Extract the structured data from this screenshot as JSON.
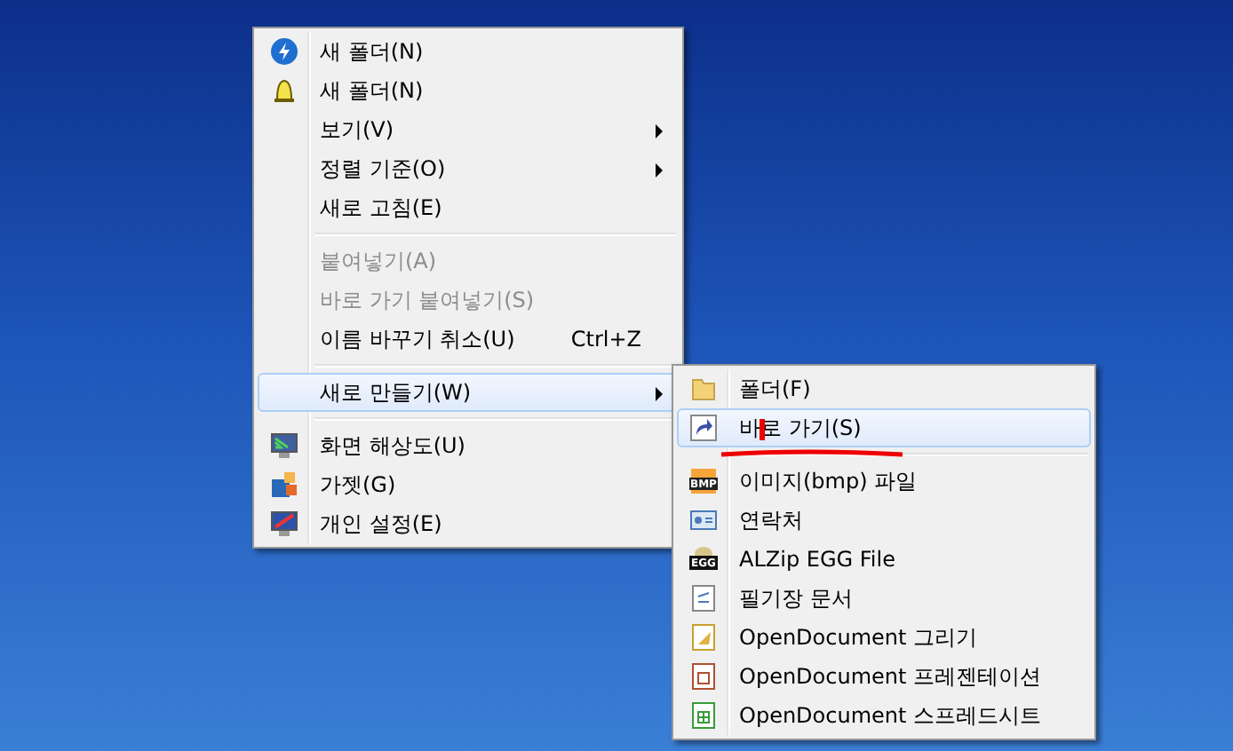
{
  "context_menu": {
    "items": [
      {
        "kind": "item",
        "label": "새 폴더(N)",
        "disabled": false,
        "selected": false,
        "submenu": false
      },
      {
        "kind": "item",
        "label": "새 폴더(N)",
        "disabled": false,
        "selected": false,
        "submenu": false
      },
      {
        "kind": "item",
        "label": "보기(V)",
        "disabled": false,
        "selected": false,
        "submenu": true
      },
      {
        "kind": "item",
        "label": "정렬 기준(O)",
        "disabled": false,
        "selected": false,
        "submenu": true
      },
      {
        "kind": "item",
        "label": "새로 고침(E)",
        "disabled": false,
        "selected": false,
        "submenu": false
      },
      {
        "kind": "separator"
      },
      {
        "kind": "item",
        "label": "붙여넣기(A)",
        "disabled": true,
        "selected": false,
        "submenu": false
      },
      {
        "kind": "item",
        "label": "바로 가기 붙여넣기(S)",
        "disabled": true,
        "selected": false,
        "submenu": false
      },
      {
        "kind": "item",
        "label": "이름 바꾸기 취소(U)",
        "shortcut": "Ctrl+Z",
        "disabled": false,
        "selected": false,
        "submenu": false
      },
      {
        "kind": "separator"
      },
      {
        "kind": "item",
        "label": "새로 만들기(W)",
        "disabled": false,
        "selected": true,
        "submenu": true
      },
      {
        "kind": "separator"
      },
      {
        "kind": "item",
        "label": "화면 해상도(U)",
        "disabled": false,
        "selected": false,
        "submenu": false
      },
      {
        "kind": "item",
        "label": "가젯(G)",
        "disabled": false,
        "selected": false,
        "submenu": false
      },
      {
        "kind": "item",
        "label": "개인 설정(E)",
        "disabled": false,
        "selected": false,
        "submenu": false
      }
    ]
  },
  "submenu": {
    "items": [
      {
        "kind": "item",
        "label": "폴더(F)",
        "selected": false
      },
      {
        "kind": "item",
        "label": "바로 가기(S)",
        "selected": true
      },
      {
        "kind": "separator"
      },
      {
        "kind": "item",
        "label": "이미지(bmp) 파일",
        "icon_text": "BMP",
        "selected": false
      },
      {
        "kind": "item",
        "label": "연락처",
        "selected": false
      },
      {
        "kind": "item",
        "label": "ALZip EGG File",
        "icon_text": "EGG",
        "selected": false
      },
      {
        "kind": "item",
        "label": "필기장 문서",
        "selected": false
      },
      {
        "kind": "item",
        "label": "OpenDocument 그리기",
        "selected": false
      },
      {
        "kind": "item",
        "label": "OpenDocument 프레젠테이션",
        "selected": false
      },
      {
        "kind": "item",
        "label": "OpenDocument 스프레드시트",
        "selected": false
      }
    ]
  }
}
